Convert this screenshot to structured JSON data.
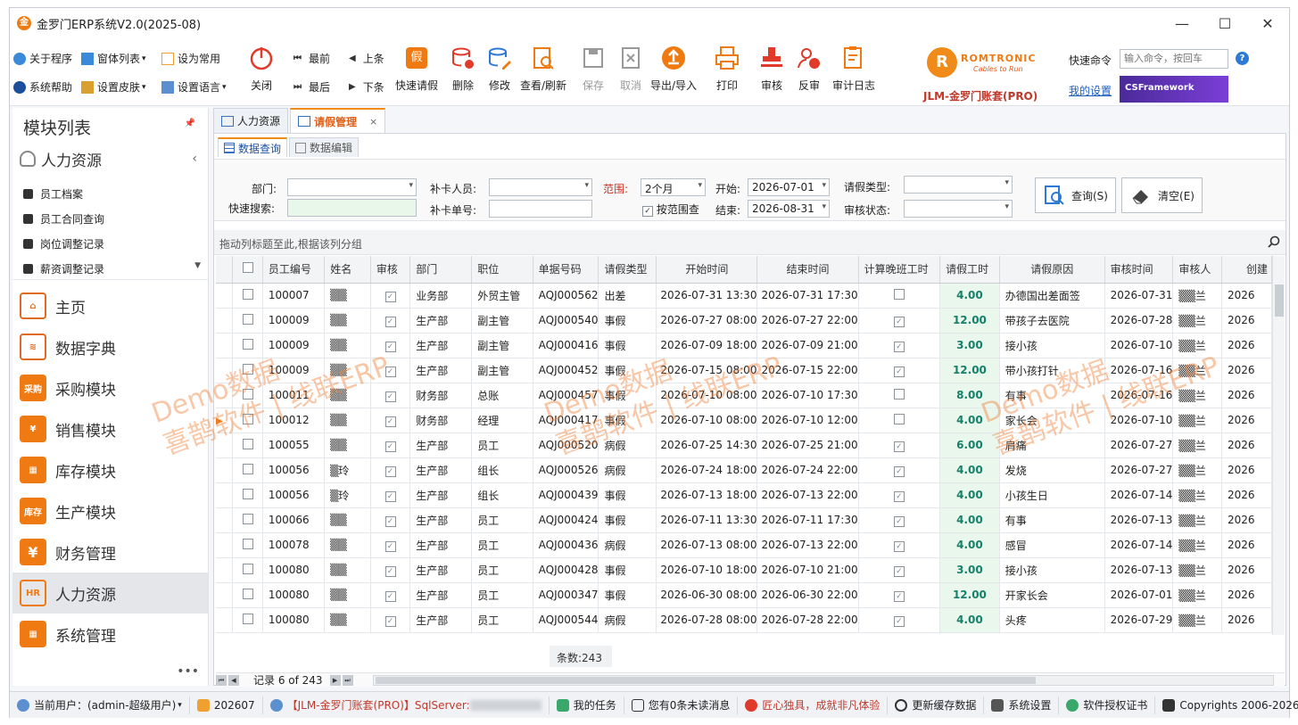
{
  "window": {
    "title": "金罗门ERP系统V2.0(2025-08)",
    "logo_text": "金"
  },
  "toolbar": {
    "about": "关于程序",
    "window_list": "窗体列表",
    "set_common": "设为常用",
    "sys_help": "系统帮助",
    "set_skin": "设置皮肤",
    "set_lang": "设置语言",
    "close": "关闭",
    "first": "最前",
    "prev": "上条",
    "last": "最后",
    "next": "下条",
    "quick_leave": "快速请假",
    "delete": "删除",
    "edit": "修改",
    "view_refresh": "查看/刷新",
    "save": "保存",
    "cancel": "取消",
    "export_import": "导出/导入",
    "print": "打印",
    "approve": "审核",
    "unapprove": "反审",
    "audit_log": "审计日志"
  },
  "brand": {
    "name": "ROMTRONIC",
    "tagline": "Cables to Run",
    "suite": "JLM-金罗门账套(PRO)"
  },
  "quick": {
    "label": "快速命令",
    "placeholder": "输入命令，按回车",
    "my_settings": "我的设置",
    "csf": "CSFramework"
  },
  "sidebar": {
    "title": "模块列表",
    "hr_group": "人力资源",
    "sub_items": [
      "员工档案",
      "员工合同查询",
      "岗位调整记录",
      "薪资调整记录"
    ],
    "modules": [
      {
        "label": "主页",
        "color": "#e06a20",
        "icon": ""
      },
      {
        "label": "数据字典",
        "color": "#e06a20",
        "icon": ""
      },
      {
        "label": "采购模块",
        "color": "#f07a12",
        "icon": "采购"
      },
      {
        "label": "销售模块",
        "color": "#f07a12",
        "icon": "¥"
      },
      {
        "label": "库存模块",
        "color": "#f07a12",
        "icon": ""
      },
      {
        "label": "生产模块",
        "color": "#f07a12",
        "icon": "库存"
      },
      {
        "label": "财务管理",
        "color": "#f07a12",
        "icon": "¥"
      },
      {
        "label": "人力资源",
        "color": "#f07a12",
        "icon": "HR"
      },
      {
        "label": "系统管理",
        "color": "#f07a12",
        "icon": ""
      }
    ],
    "more": "•••"
  },
  "tabs": {
    "hr": "人力资源",
    "leave": "请假管理",
    "close": "×"
  },
  "subtabs": {
    "query": "数据查询",
    "edit": "数据编辑"
  },
  "filter": {
    "dept_label": "部门:",
    "quick_search_label": "快速搜索:",
    "card_person_label": "补卡人员:",
    "card_no_label": "补卡单号:",
    "range_label": "范围:",
    "range_value": "2个月",
    "by_range": "按范围查",
    "start_label": "开始:",
    "start_value": "2026-07-01",
    "end_label": "结束:",
    "end_value": "2026-08-31",
    "leave_type_label": "请假类型:",
    "audit_status_label": "审核状态:",
    "query_btn": "查询(S)",
    "clear_btn": "清空(E)"
  },
  "group_hint": "拖动列标题至此,根据该列分组",
  "columns": [
    "员工编号",
    "姓名",
    "审核",
    "部门",
    "职位",
    "单据号码",
    "请假类型",
    "开始时间",
    "结束时间",
    "计算晚班工时",
    "请假工时",
    "请假原因",
    "审核时间",
    "审核人",
    "创建"
  ],
  "rows": [
    {
      "id": "100007",
      "name": "▒▒",
      "dept": "业务部",
      "pos": "外贸主管",
      "doc": "AQJ000562",
      "type": "出差",
      "start": "2026-07-31 13:30",
      "end": "2026-07-31 17:30",
      "night": false,
      "hours": "4.00",
      "reason": "办德国出差面签",
      "atime": "2026-07-31",
      "auditor": "▒▒兰",
      "create": "2026"
    },
    {
      "id": "100009",
      "name": "▒▒",
      "dept": "生产部",
      "pos": "副主管",
      "doc": "AQJ000540",
      "type": "事假",
      "start": "2026-07-27 08:00",
      "end": "2026-07-27 22:00",
      "night": true,
      "hours": "12.00",
      "reason": "带孩子去医院",
      "atime": "2026-07-28",
      "auditor": "▒▒兰",
      "create": "2026"
    },
    {
      "id": "100009",
      "name": "▒▒",
      "dept": "生产部",
      "pos": "副主管",
      "doc": "AQJ000416",
      "type": "事假",
      "start": "2026-07-09 18:00",
      "end": "2026-07-09 21:00",
      "night": true,
      "hours": "3.00",
      "reason": "接小孩",
      "atime": "2026-07-10",
      "auditor": "▒▒兰",
      "create": "2026"
    },
    {
      "id": "100009",
      "name": "▒▒",
      "dept": "生产部",
      "pos": "副主管",
      "doc": "AQJ000452",
      "type": "事假",
      "start": "2026-07-15 08:00",
      "end": "2026-07-15 22:00",
      "night": true,
      "hours": "12.00",
      "reason": "带小孩打针",
      "atime": "2026-07-16",
      "auditor": "▒▒兰",
      "create": "2026"
    },
    {
      "id": "100011",
      "name": "▒▒",
      "dept": "财务部",
      "pos": "总账",
      "doc": "AQJ000457",
      "type": "事假",
      "start": "2026-07-10 08:00",
      "end": "2026-07-10 17:30",
      "night": false,
      "hours": "8.00",
      "reason": "有事",
      "atime": "2026-07-16",
      "auditor": "▒▒兰",
      "create": "2026"
    },
    {
      "id": "100012",
      "name": "▒▒",
      "dept": "财务部",
      "pos": "经理",
      "doc": "AQJ000417",
      "type": "事假",
      "start": "2026-07-10 08:00",
      "end": "2026-07-10 12:00",
      "night": false,
      "hours": "4.00",
      "reason": "家长会",
      "atime": "2026-07-10",
      "auditor": "▒▒兰",
      "create": "2026"
    },
    {
      "id": "100055",
      "name": "▒▒",
      "dept": "生产部",
      "pos": "员工",
      "doc": "AQJ000520",
      "type": "病假",
      "start": "2026-07-25 14:30",
      "end": "2026-07-25 21:00",
      "night": true,
      "hours": "6.00",
      "reason": "肩痛",
      "atime": "2026-07-27",
      "auditor": "▒▒兰",
      "create": "2026"
    },
    {
      "id": "100056",
      "name": "▒玲",
      "dept": "生产部",
      "pos": "组长",
      "doc": "AQJ000526",
      "type": "病假",
      "start": "2026-07-24 18:00",
      "end": "2026-07-24 22:00",
      "night": true,
      "hours": "4.00",
      "reason": "发烧",
      "atime": "2026-07-27",
      "auditor": "▒▒兰",
      "create": "2026"
    },
    {
      "id": "100056",
      "name": "▒玲",
      "dept": "生产部",
      "pos": "组长",
      "doc": "AQJ000439",
      "type": "事假",
      "start": "2026-07-13 18:00",
      "end": "2026-07-13 22:00",
      "night": true,
      "hours": "4.00",
      "reason": "小孩生日",
      "atime": "2026-07-14",
      "auditor": "▒▒兰",
      "create": "2026"
    },
    {
      "id": "100066",
      "name": "▒▒",
      "dept": "生产部",
      "pos": "员工",
      "doc": "AQJ000424",
      "type": "事假",
      "start": "2026-07-11 13:30",
      "end": "2026-07-11 17:30",
      "night": true,
      "hours": "4.00",
      "reason": "有事",
      "atime": "2026-07-13",
      "auditor": "▒▒兰",
      "create": "2026"
    },
    {
      "id": "100078",
      "name": "▒▒",
      "dept": "生产部",
      "pos": "员工",
      "doc": "AQJ000436",
      "type": "病假",
      "start": "2026-07-13 08:00",
      "end": "2026-07-13 22:00",
      "night": true,
      "hours": "4.00",
      "reason": "感冒",
      "atime": "2026-07-14",
      "auditor": "▒▒兰",
      "create": "2026"
    },
    {
      "id": "100080",
      "name": "▒▒",
      "dept": "生产部",
      "pos": "员工",
      "doc": "AQJ000428",
      "type": "事假",
      "start": "2026-07-10 18:00",
      "end": "2026-07-10 21:00",
      "night": true,
      "hours": "3.00",
      "reason": "接小孩",
      "atime": "2026-07-13",
      "auditor": "▒▒兰",
      "create": "2026"
    },
    {
      "id": "100080",
      "name": "▒▒",
      "dept": "生产部",
      "pos": "员工",
      "doc": "AQJ000347",
      "type": "事假",
      "start": "2026-06-30 08:00",
      "end": "2026-06-30 22:00",
      "night": true,
      "hours": "12.00",
      "reason": "开家长会",
      "atime": "2026-07-01",
      "auditor": "▒▒兰",
      "create": "2026"
    },
    {
      "id": "100080",
      "name": "▒▒",
      "dept": "生产部",
      "pos": "员工",
      "doc": "AQJ000544",
      "type": "病假",
      "start": "2026-07-28 08:00",
      "end": "2026-07-28 22:00",
      "night": true,
      "hours": "4.00",
      "reason": "头疼",
      "atime": "2026-07-29",
      "auditor": "▒▒兰",
      "create": "2026"
    }
  ],
  "footer": {
    "count": "条数:243",
    "record": "记录 6 of 243"
  },
  "watermark": {
    "line1": "Demo数据",
    "line2": "喜鹊软件 | 线联ERP"
  },
  "status": {
    "user": "当前用户：(admin-超级用户)",
    "period": "202607",
    "db": "【JLM-金罗门账套(PRO)】SqlServer:",
    "tasks": "我的任务",
    "messages": "您有0条未读消息",
    "slogan": "匠心独具，成就非凡体验",
    "refresh_cache": "更新缓存数据",
    "sys_settings": "系统设置",
    "license": "软件授权证书",
    "copyright": "Copyrights 2006-2026 ,"
  },
  "colors": {
    "accent": "#f07a12",
    "hours_bg": "#eaf7ec",
    "hours_fg": "#16806a",
    "link": "#1a5cc0"
  }
}
